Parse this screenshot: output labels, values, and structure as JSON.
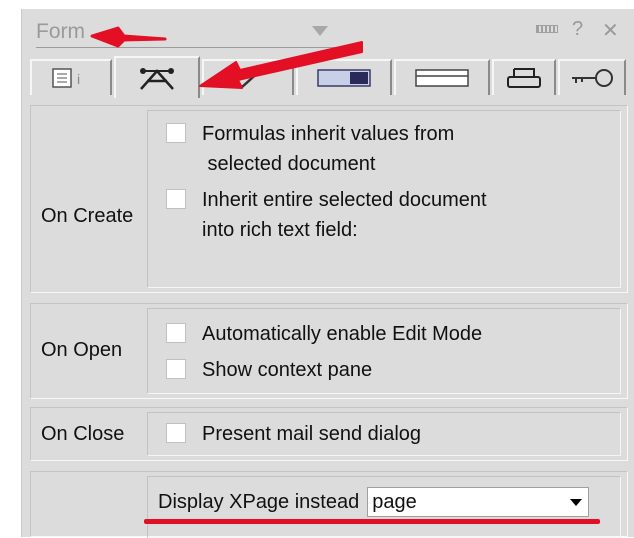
{
  "window": {
    "title": "Form",
    "help_label": "?",
    "close_label": "✕"
  },
  "tabs": [
    {
      "icon": "info-icon"
    },
    {
      "icon": "form-properties-icon",
      "active": true
    },
    {
      "icon": "pencil-check-icon"
    },
    {
      "icon": "background-icon"
    },
    {
      "icon": "header-icon"
    },
    {
      "icon": "printer-icon"
    },
    {
      "icon": "key-icon"
    }
  ],
  "sections": {
    "on_create": {
      "label": "On Create",
      "options": [
        {
          "line1": "Formulas inherit values from",
          "line2": " selected document",
          "checked": false
        },
        {
          "line1": "Inherit entire selected document",
          "line2": "into rich text field:",
          "checked": false
        }
      ]
    },
    "on_open": {
      "label": "On Open",
      "options": [
        {
          "line1": "Automatically enable Edit Mode",
          "checked": false
        },
        {
          "line1": "Show context pane",
          "checked": false
        }
      ]
    },
    "on_close": {
      "label": "On Close",
      "options": [
        {
          "line1": "Present mail send dialog",
          "checked": false
        }
      ]
    },
    "xpage": {
      "label": "Display XPage instead",
      "value": "page"
    }
  },
  "colors": {
    "annotation_red": "#e30f24",
    "panel_bg": "#dcdcdc"
  }
}
